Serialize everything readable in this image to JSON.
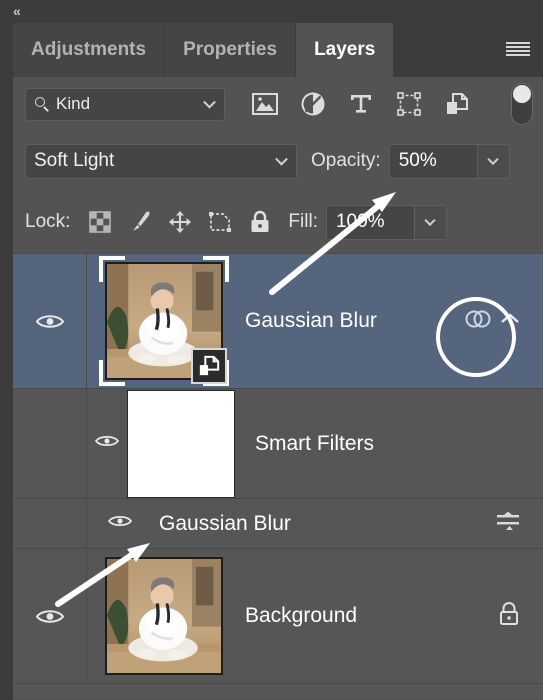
{
  "window": {
    "collapse_arrows": "«"
  },
  "tabs": [
    {
      "label": "Adjustments",
      "active": false
    },
    {
      "label": "Properties",
      "active": false
    },
    {
      "label": "Layers",
      "active": true
    }
  ],
  "panel_menu": {
    "icon": "hamburger-menu-icon"
  },
  "filter_bar": {
    "kind_label": "Kind",
    "search_icon": "search-icon",
    "dropdown_icon": "chevron-down-icon",
    "filter_icons": [
      "pixel-layer-filter-icon",
      "adjustment-layer-filter-icon",
      "type-layer-filter-icon",
      "shape-layer-filter-icon",
      "smart-object-filter-icon"
    ],
    "toggle_icon": "filter-enable-toggle",
    "toggle_state": "on"
  },
  "blend_bar": {
    "blend_mode": "Soft Light",
    "opacity_label": "Opacity:",
    "opacity_value": "50%",
    "dropdown_icon": "chevron-down-icon"
  },
  "lock_bar": {
    "lock_label": "Lock:",
    "lock_icons": [
      "lock-transparent-pixels-icon",
      "lock-image-pixels-icon",
      "lock-position-icon",
      "lock-artboard-nesting-icon",
      "lock-all-icon"
    ],
    "fill_label": "Fill:",
    "fill_value": "100%"
  },
  "layers": [
    {
      "name": "Gaussian Blur",
      "selected": true,
      "visible": true,
      "visibility_icon": "eye-icon",
      "thumbnail": "ballerina-photo-thumbnail",
      "badge": "smart-object-badge-icon",
      "right_icons": [
        "smart-filters-icon",
        "chevron-up-icon"
      ]
    },
    {
      "name": "Smart Filters",
      "type": "smart-filter-group",
      "visible": true,
      "visibility_icon": "eye-icon",
      "thumbnail": "smart-filter-mask-thumbnail"
    },
    {
      "name": "Gaussian Blur",
      "type": "smart-filter-entry",
      "visible": true,
      "visibility_icon": "eye-icon",
      "right_icons": [
        "filter-blending-options-icon"
      ]
    },
    {
      "name": "Background",
      "selected": false,
      "visible": true,
      "visibility_icon": "eye-icon",
      "thumbnail": "ballerina-photo-thumbnail",
      "right_icons": [
        "lock-icon"
      ]
    }
  ],
  "annotations": [
    {
      "type": "arrow",
      "target": "opacity-field",
      "name": "arrow-to-opacity"
    },
    {
      "type": "arrow",
      "target": "smart-filter-eye",
      "name": "arrow-to-filter-visibility"
    },
    {
      "type": "circle",
      "target": "smart-filters-icon",
      "name": "circle-around-smart-filters-icon"
    }
  ],
  "colors": {
    "panel_bg": "#535353",
    "row_bg": "#565656",
    "selected_row": "#56657E",
    "tab_active": "#535353",
    "tab_inactive": "#454545",
    "text": "#FFFFFF",
    "annotation": "#FFFFFF"
  }
}
